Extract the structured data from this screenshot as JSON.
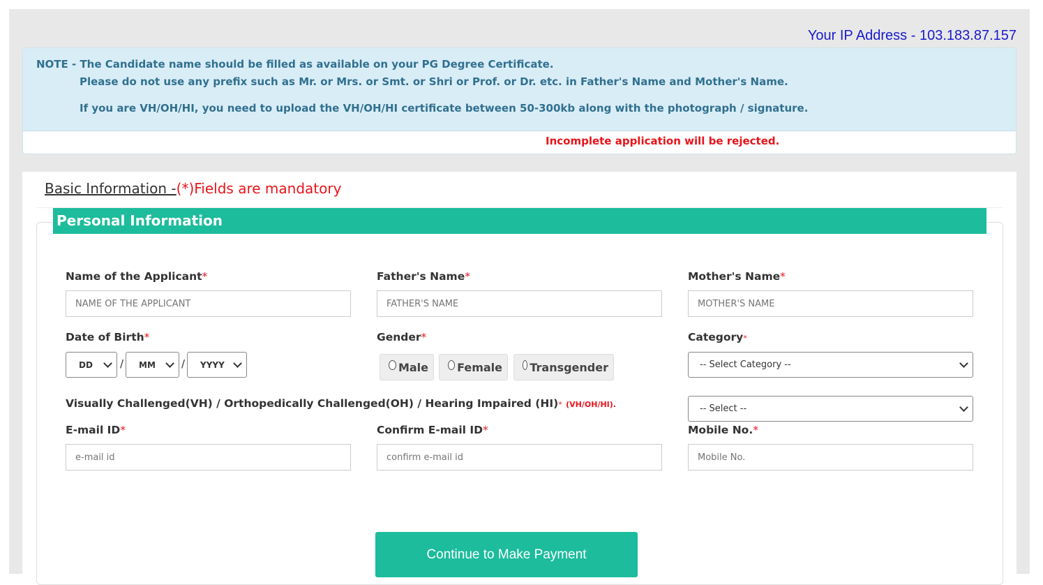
{
  "ip": {
    "label": "Your IP Address -",
    "value": "103.183.87.157"
  },
  "note": {
    "line1": "NOTE - The Candidate name should be filled as available on your PG Degree Certificate.",
    "line2": "Please do not use any prefix such as Mr. or Mrs. or Smt. or Shri or Prof. or Dr. etc. in Father's Name and Mother's Name.",
    "line3": "If you are VH/OH/HI, you need to upload the VH/OH/HI certificate between 50-300kb along with the photograph / signature.",
    "reject": "Incomplete application will be rejected."
  },
  "basic": {
    "title": "Basic Information -",
    "mandatory": "(*)Fields are mandatory"
  },
  "section": {
    "title": "Personal Information"
  },
  "fields": {
    "applicant": {
      "label": "Name of the Applicant",
      "placeholder": "NAME OF THE APPLICANT"
    },
    "father": {
      "label": "Father's Name",
      "placeholder": "FATHER'S NAME"
    },
    "mother": {
      "label": "Mother's Name",
      "placeholder": "MOTHER'S NAME"
    },
    "dob": {
      "label": "Date of Birth",
      "day": "DD",
      "month": "MM",
      "year": "YYYY",
      "sep": "/"
    },
    "gender": {
      "label": "Gender",
      "options": [
        "Male",
        "Female",
        "Transgender"
      ]
    },
    "category": {
      "label": "Category",
      "value": "-- Select Category --"
    },
    "vh": {
      "label": "Visually Challenged(VH) / Orthopedically Challenged(OH) / Hearing Impaired (HI)",
      "note": "(VH/OH/HI).",
      "value": "-- Select --"
    },
    "email": {
      "label": "E-mail ID",
      "placeholder": "e-mail id"
    },
    "confirm_email": {
      "label": "Confirm E-mail ID",
      "placeholder": "confirm e-mail id"
    },
    "mobile": {
      "label": "Mobile No.",
      "placeholder": "Mobile No."
    }
  },
  "required_mark": "*",
  "button": {
    "label": "Continue to Make Payment"
  },
  "colors": {
    "accent": "#1cbc9c",
    "required": "#e8141b",
    "ip": "#1a1acc",
    "note_bg": "#d9edf7",
    "note_text": "#31708f"
  }
}
